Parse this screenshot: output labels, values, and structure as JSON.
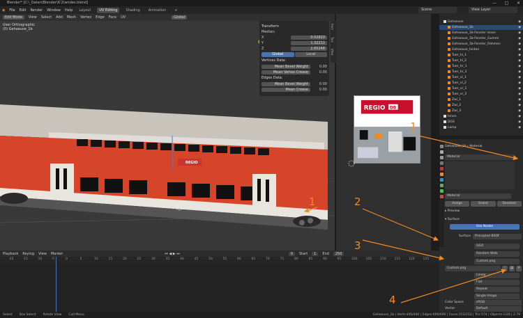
{
  "titlebar": {
    "title": "Blender* [C:\\_Daten\\Blender\\IC2\\wndes.blend]",
    "controls": [
      "—",
      "□",
      "✕"
    ]
  },
  "menubar": {
    "items": [
      "File",
      "Edit",
      "Render",
      "Window",
      "Help"
    ],
    "workspaces": [
      "Layout",
      "UV Editing",
      "Shading",
      "Animation"
    ],
    "active_workspace": "UV Editing",
    "add_tab": "+",
    "scene_label": "Scene",
    "viewlayer_label": "View Layer"
  },
  "viewport": {
    "mode": "Edit Mode",
    "menus": [
      "View",
      "Select",
      "Add",
      "Mesh",
      "Vertex",
      "Edge",
      "Face",
      "UV"
    ],
    "orientation": "Global",
    "info_line1": "User Orthographic",
    "info_line2": "(0) Gehaeuse_1b"
  },
  "transform": {
    "title": "Transform",
    "median_label": "Median:",
    "x_label": "X",
    "x_value": "0.02823",
    "y_label": "Y",
    "y_value": "1.32211",
    "z_label": "Z",
    "z_value": "2.65248",
    "global": "Global",
    "local": "Local",
    "vertices_head": "Vertices Data:",
    "mean_bevel": "Mean Bevel Weight",
    "mean_bevel_val": "0.00",
    "mean_vcrease": "Mean Vertex Crease",
    "mean_vcrease_val": "0.00",
    "edges_head": "Edges Data:",
    "mean_bevel2": "Mean Bevel Weight",
    "mean_bevel2_val": "0.00",
    "mean_crease": "Mean Crease",
    "mean_crease_val": "0.00"
  },
  "sidetabs": [
    "Item",
    "Tool",
    "View"
  ],
  "uv_texture_text": {
    "regio": "REGIO",
    "db": "DB"
  },
  "car_label": "REGIO",
  "annotations": [
    "1",
    "2",
    "3",
    "1",
    "4"
  ],
  "timeline": {
    "menus": [
      "Playback",
      "Keying",
      "View",
      "Marker"
    ],
    "current_frame": "0",
    "start_label": "Start",
    "start": "1",
    "end_label": "End",
    "end": "250",
    "ruler": [
      "-25",
      "-15",
      "-10",
      "-5",
      "0",
      "5",
      "10",
      "15",
      "20",
      "25",
      "30",
      "35",
      "40",
      "45",
      "50",
      "55",
      "60",
      "65",
      "70",
      "75",
      "80",
      "85",
      "90",
      "95",
      "100",
      "105",
      "110",
      "115",
      "120",
      "125"
    ]
  },
  "outliner": {
    "rows": [
      {
        "name": "Gehaeuse",
        "level": 0
      },
      {
        "name": "Gehaeuse_1b",
        "level": 1,
        "selected": true
      },
      {
        "name": "Gehaeuse_1b-Fenster innen",
        "level": 1
      },
      {
        "name": "Gehaeuse_1b-Fenster_Gummi",
        "level": 1
      },
      {
        "name": "Gehaeuse_1b-Fenster_Rahmen",
        "level": 1
      },
      {
        "name": "Gehaeuse_hinten",
        "level": 1
      },
      {
        "name": "Tuer_hl_1",
        "level": 1
      },
      {
        "name": "Tuer_hl_2",
        "level": 1
      },
      {
        "name": "Tuer_hr_1",
        "level": 1
      },
      {
        "name": "Tuer_hr_2",
        "level": 1
      },
      {
        "name": "Tuer_vl_1",
        "level": 1
      },
      {
        "name": "Tuer_vl_2",
        "level": 1
      },
      {
        "name": "Tuer_vr_1",
        "level": 1
      },
      {
        "name": "Tuer_vr_2",
        "level": 1
      },
      {
        "name": "Zwi_1",
        "level": 1
      },
      {
        "name": "Zwi_2",
        "level": 1
      },
      {
        "name": "Zwi_3",
        "level": 1
      },
      {
        "name": "Innen",
        "level": 0
      },
      {
        "name": "DGS",
        "level": 0
      },
      {
        "name": "Lamp",
        "level": 0
      }
    ]
  },
  "properties": {
    "breadcrumb_obj": "Gehaeuse_1b",
    "breadcrumb_mat": "Material",
    "slot_name": "Material",
    "material_name": "Material",
    "assign": "Assign",
    "select": "Select",
    "deselect": "Deselect",
    "preview": "Preview",
    "surface_head": "Surface",
    "use_nodes": "Use Nodes",
    "surface_label": "Surface",
    "surface_value": "Principled BSDF",
    "ggx": "GGX",
    "random_walk": "Random Walk",
    "base_color": "Custom.png",
    "image_name": "Custom.png",
    "linear": "Linear",
    "flat": "Flat",
    "repeat": "Repeat",
    "single_image": "Single Image",
    "color_space_label": "Color Space",
    "color_space": "sRGB",
    "vector_label": "Vector",
    "vector_value": "Default"
  },
  "statusbar": {
    "items": [
      "Select",
      "Box Select",
      "Rotate View",
      "Call Menu"
    ],
    "stats": "Gehaeuse_1b | Verts:440/440 | Edges:690/690 | Faces:253/253 | Tris:574 | Objects:1/28 | 2.79"
  },
  "colors": {
    "accent": "#4772b3",
    "orange": "#f08a24",
    "train_red": "#d6452a"
  }
}
